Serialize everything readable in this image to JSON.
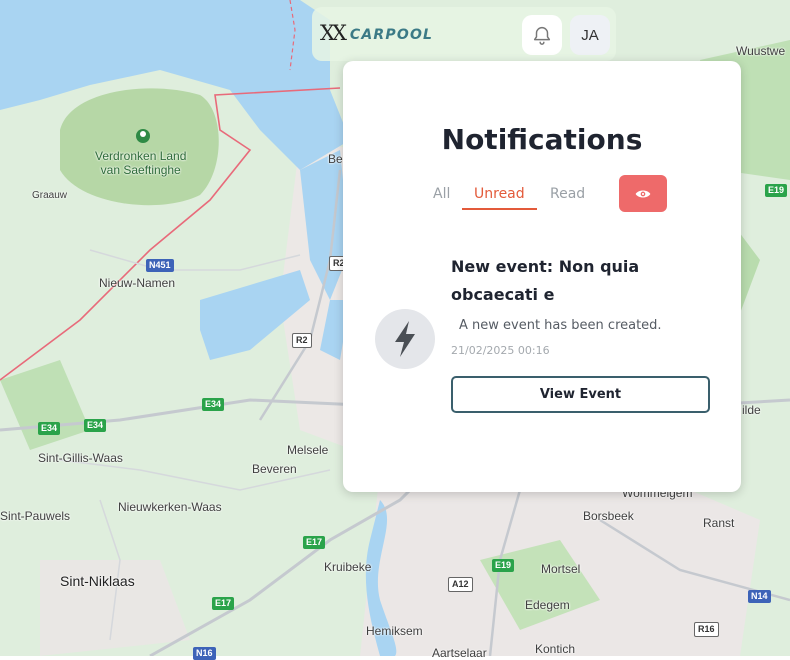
{
  "header": {
    "logo_mark": "XX",
    "logo_text": "CARPOOL",
    "avatar_initials": "JA"
  },
  "notifications": {
    "title": "Notifications",
    "tabs": [
      {
        "label": "All",
        "active": false
      },
      {
        "label": "Unread",
        "active": true
      },
      {
        "label": "Read",
        "active": false
      }
    ],
    "items": [
      {
        "title": "New event: Non quia obcaecati e",
        "body": "A new event has been created.",
        "time": "21/02/2025 00:16",
        "action_label": "View Event",
        "icon": "lightning-icon"
      }
    ]
  },
  "map": {
    "places": [
      "Verdronken Land van Saeftinghe",
      "Graauw",
      "Nieuw-Namen",
      "Be",
      "Melsele",
      "Beveren",
      "Sint-Gillis-Waas",
      "Nieuwkerken-Waas",
      "Sint-Pauwels",
      "Sint-Niklaas",
      "Kruibeke",
      "Hemiksem",
      "Edegem",
      "Mortsel",
      "Borsbeek",
      "Ranst",
      "Wommelgem",
      "Kontich",
      "Aartselaar",
      "Wuustwe",
      "ilde"
    ],
    "roads": [
      "N451",
      "R2",
      "R2",
      "E34",
      "E34",
      "E34",
      "E17",
      "E17",
      "E19",
      "E19",
      "A12",
      "N14",
      "R16",
      "N16"
    ]
  },
  "colors": {
    "accent": "#e35a3a",
    "eye_button": "#ee6a6a",
    "logo_text": "#3b7a86",
    "button_border": "#3a5f6c"
  }
}
